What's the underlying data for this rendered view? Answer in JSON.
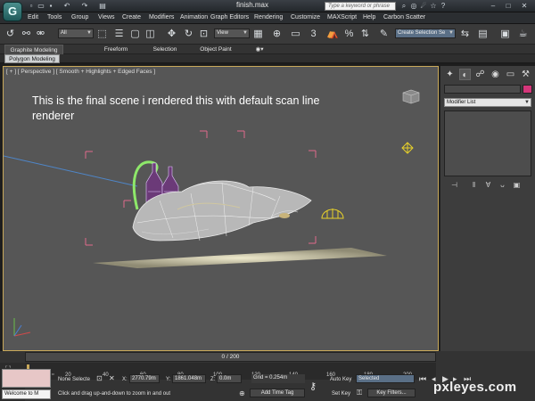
{
  "window": {
    "title": "finish.max",
    "search_placeholder": "Type a keyword or phrase"
  },
  "menu": [
    "Edit",
    "Tools",
    "Group",
    "Views",
    "Create",
    "Modifiers",
    "Animation",
    "Graph Editors",
    "Rendering",
    "Customize",
    "MAXScript",
    "Help",
    "Carbon Scatter"
  ],
  "toolbar": {
    "selection_filter": "All",
    "reference_coord": "View",
    "named_selection_placeholder": "Create Selection Se"
  },
  "ribbon": {
    "tabs": [
      "Graphite Modeling Tools",
      "Freeform",
      "Selection",
      "Object Paint"
    ],
    "panel_tab": "Polygon Modeling"
  },
  "viewport": {
    "label": "[ + ] [ Perspective ] [ Smooth + Highlights + Edged Faces ]",
    "note": "This is the final scene i rendered this with default scan line renderer"
  },
  "command_panel": {
    "modifier_list": "Modifier List",
    "object_color": "#d4367a"
  },
  "timeline": {
    "frame_display": "0 / 200",
    "ticks": [
      "0",
      "20",
      "40",
      "60",
      "80",
      "100",
      "120",
      "140",
      "160",
      "180",
      "200"
    ]
  },
  "status": {
    "maxscript_text": "Welcome to M",
    "selection_text": "None Selecte",
    "x_label": "X:",
    "x_value": "2770.79m",
    "y_label": "Y:",
    "y_value": "1861.048m",
    "z_label": "Z:",
    "z_value": "0.0m",
    "grid": "Grid = 0.254m",
    "prompt": "Click and drag up-and-down to zoom in and out",
    "add_time_tag": "Add Time Tag",
    "auto_key": "Auto Key",
    "auto_key_mode": "Selected",
    "set_key": "Set Key",
    "key_filters": "Key Filters..."
  },
  "watermark": {
    "text": "pxleyes",
    "suffix": ".com"
  },
  "icons": {
    "app": "3ds-max-app-icon",
    "accent": "#c9a95a"
  }
}
